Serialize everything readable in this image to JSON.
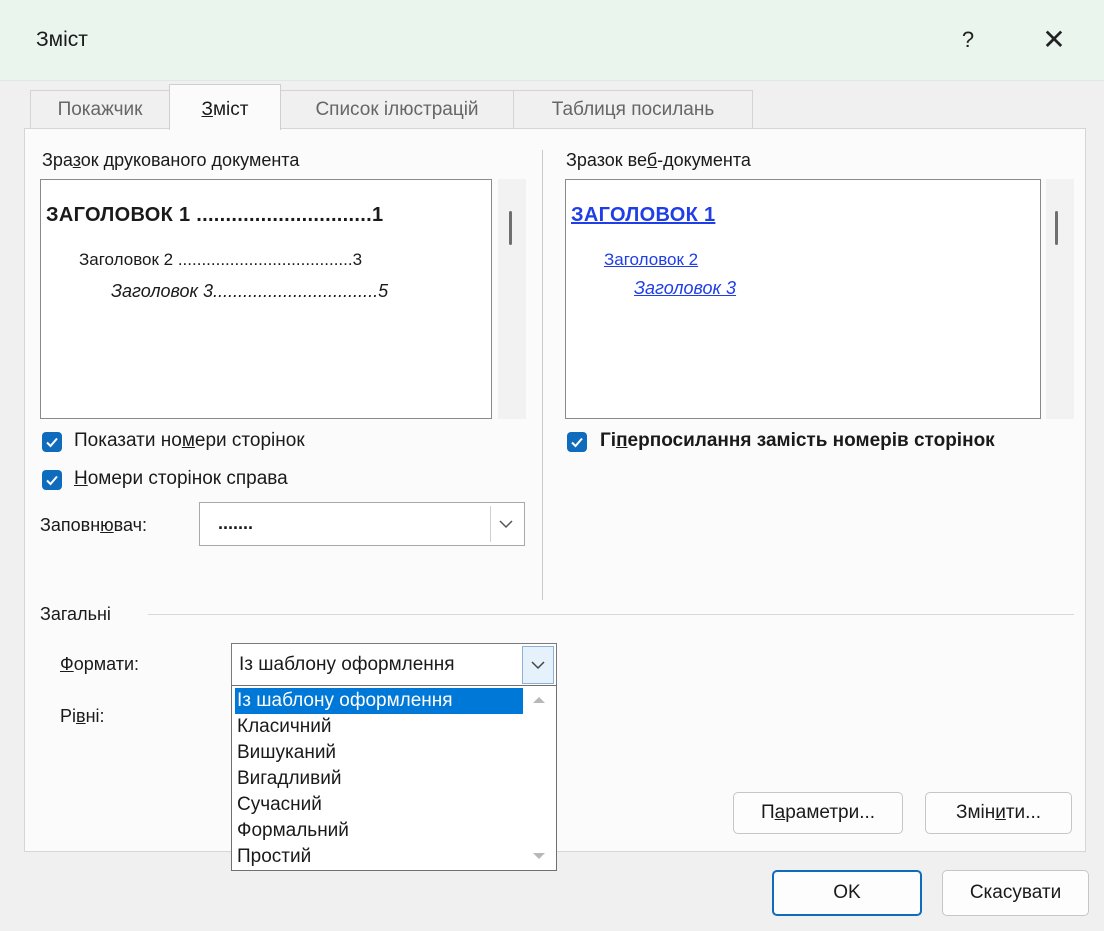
{
  "window": {
    "title": "Зміст",
    "help": "?",
    "close": "✕"
  },
  "tabs": [
    {
      "label": "Покажчик"
    },
    {
      "label_pre": "",
      "label_mn": "З",
      "label_post": "міст"
    },
    {
      "label": "Список ілюстрацій"
    },
    {
      "label": "Таблиця посилань"
    }
  ],
  "print_preview": {
    "label_pre": "Зра",
    "label_mn": "з",
    "label_post": "ок друкованого документа",
    "h1": "ЗАГОЛОВОК 1 ..............................1",
    "h2": "Заголовок 2 .....................................3",
    "h3": "Заголовок 3.................................5"
  },
  "web_preview": {
    "label_pre": "Зразок ве",
    "label_mn": "б",
    "label_post": "-документа",
    "h1": "ЗАГОЛОВОК 1",
    "h2": "Заголовок 2",
    "h3": "Заголовок 3"
  },
  "options": {
    "show_page_numbers": {
      "pre": "Показати но",
      "mn": "м",
      "post": "ери сторінок",
      "checked": true
    },
    "right_align": {
      "pre": "",
      "mn": "Н",
      "post": "омери сторінок справа",
      "checked": true
    },
    "hyperlinks": {
      "pre": "Гі",
      "mn": "п",
      "post": "ерпосилання замість номерів сторінок",
      "checked": true
    },
    "leader": {
      "label_pre": "Заповн",
      "label_mn": "ю",
      "label_post": "вач:",
      "value": "......."
    }
  },
  "general": {
    "label": "Загальні",
    "formats_label_mn": "Ф",
    "formats_label_post": "ормати:",
    "formats_value": "Із шаблону оформлення",
    "levels_label_pre": "Рі",
    "levels_label_mn": "в",
    "levels_label_post": "ні:",
    "formats_options": [
      "Із шаблону оформлення",
      "Класичний",
      "Вишуканий",
      "Вигадливий",
      "Сучасний",
      "Формальний",
      "Простий"
    ]
  },
  "buttons": {
    "options_pre": "П",
    "options_mn": "а",
    "options_post": "раметри...",
    "modify_pre": "Змін",
    "modify_mn": "и",
    "modify_post": "ти...",
    "ok": "OK",
    "cancel": "Скасувати"
  },
  "colors": {
    "accent": "#0f6cbd",
    "link": "#1f3ee6",
    "titlebar": "#eaf5ee",
    "selection": "#0078d7"
  }
}
